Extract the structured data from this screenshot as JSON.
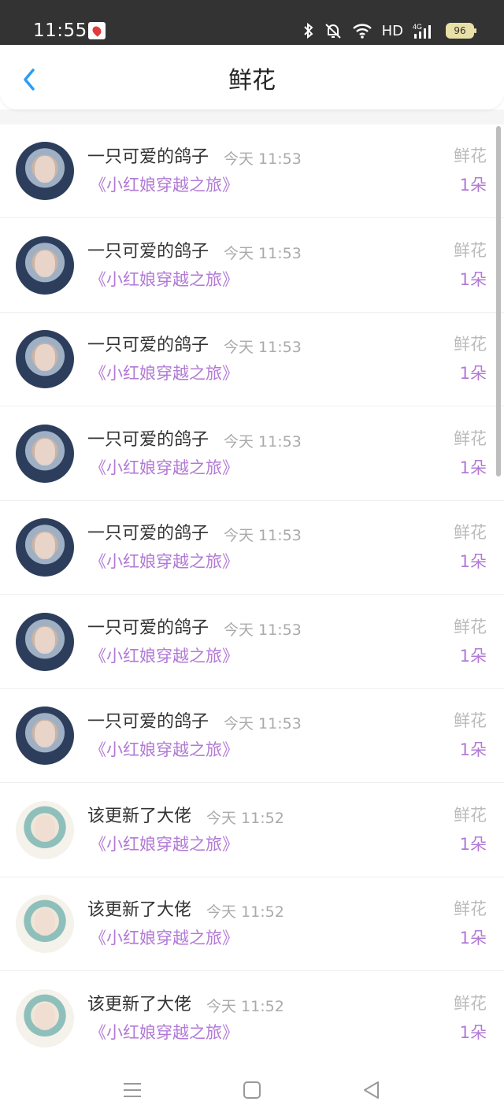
{
  "status_bar": {
    "time": "11:55",
    "network_label": "HD",
    "battery_level": "96"
  },
  "header": {
    "title": "鲜花",
    "back_icon": "chevron-left-icon",
    "accent_color": "#2a9df4"
  },
  "items": [
    {
      "name": "一只可爱的鸽子",
      "time": "今天 11:53",
      "book": "《小红娘穿越之旅》",
      "gift_type": "鲜花",
      "gift_count": "1朵",
      "avatar": "dark"
    },
    {
      "name": "一只可爱的鸽子",
      "time": "今天 11:53",
      "book": "《小红娘穿越之旅》",
      "gift_type": "鲜花",
      "gift_count": "1朵",
      "avatar": "dark"
    },
    {
      "name": "一只可爱的鸽子",
      "time": "今天 11:53",
      "book": "《小红娘穿越之旅》",
      "gift_type": "鲜花",
      "gift_count": "1朵",
      "avatar": "dark"
    },
    {
      "name": "一只可爱的鸽子",
      "time": "今天 11:53",
      "book": "《小红娘穿越之旅》",
      "gift_type": "鲜花",
      "gift_count": "1朵",
      "avatar": "dark"
    },
    {
      "name": "一只可爱的鸽子",
      "time": "今天 11:53",
      "book": "《小红娘穿越之旅》",
      "gift_type": "鲜花",
      "gift_count": "1朵",
      "avatar": "dark"
    },
    {
      "name": "一只可爱的鸽子",
      "time": "今天 11:53",
      "book": "《小红娘穿越之旅》",
      "gift_type": "鲜花",
      "gift_count": "1朵",
      "avatar": "dark"
    },
    {
      "name": "一只可爱的鸽子",
      "time": "今天 11:53",
      "book": "《小红娘穿越之旅》",
      "gift_type": "鲜花",
      "gift_count": "1朵",
      "avatar": "dark"
    },
    {
      "name": "该更新了大佬",
      "time": "今天 11:52",
      "book": "《小红娘穿越之旅》",
      "gift_type": "鲜花",
      "gift_count": "1朵",
      "avatar": "light"
    },
    {
      "name": "该更新了大佬",
      "time": "今天 11:52",
      "book": "《小红娘穿越之旅》",
      "gift_type": "鲜花",
      "gift_count": "1朵",
      "avatar": "light"
    },
    {
      "name": "该更新了大佬",
      "time": "今天 11:52",
      "book": "《小红娘穿越之旅》",
      "gift_type": "鲜花",
      "gift_count": "1朵",
      "avatar": "light"
    }
  ],
  "nav_bar": {
    "menu_icon": "menu-icon",
    "home_icon": "home-square-icon",
    "back_icon": "back-triangle-icon"
  },
  "colors": {
    "book_title": "#b27ad6",
    "gift_count": "#b27ad6",
    "muted": "#bbbbbb",
    "status_bar_bg": "#333333"
  }
}
